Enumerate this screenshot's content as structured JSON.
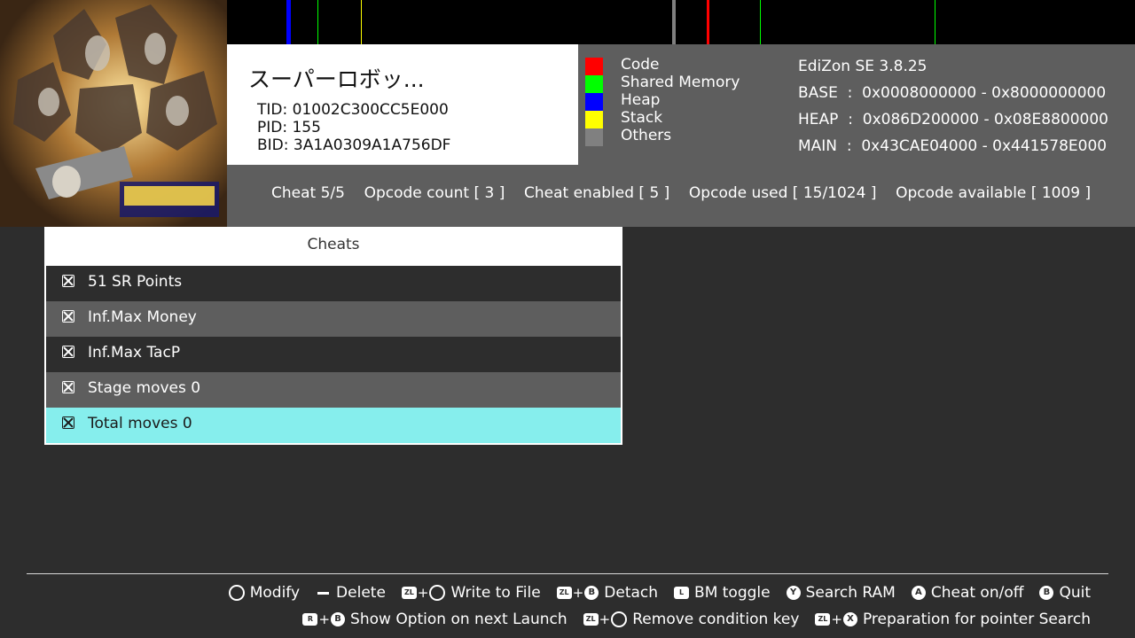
{
  "memory_legend": [
    {
      "label": "Code",
      "color": "#ff0000"
    },
    {
      "label": "Shared Memory",
      "color": "#00ff00"
    },
    {
      "label": "Heap",
      "color": "#0000ff"
    },
    {
      "label": "Stack",
      "color": "#ffff00"
    },
    {
      "label": "Others",
      "color": "#808080"
    }
  ],
  "game": {
    "title": "スーパーロボッ...",
    "tid": "TID: 01002C300CC5E000",
    "pid": "PID: 155",
    "bid": "BID: 3A1A0309A1A756DF",
    "cover_icon": "game-cover-art"
  },
  "mem_info": {
    "version": "EdiZon SE 3.8.25",
    "base": "BASE  :  0x0008000000 - 0x8000000000",
    "heap": "HEAP  :  0x086D200000 - 0x08E8800000",
    "main": "MAIN  :  0x43CAE04000 - 0x441578E000"
  },
  "stats": "Cheat 5/5    Opcode count [ 3 ]    Cheat enabled [ 5 ]    Opcode used [ 15/1024 ]    Opcode available [ 1009 ]",
  "cheats": {
    "header": "Cheats",
    "items": [
      {
        "label": "51 SR Points",
        "enabled": false,
        "selected": false
      },
      {
        "label": "Inf.Max Money",
        "enabled": false,
        "selected": false
      },
      {
        "label": "Inf.Max TacP",
        "enabled": false,
        "selected": false
      },
      {
        "label": "Stage moves 0",
        "enabled": false,
        "selected": false
      },
      {
        "label": "Total moves 0",
        "enabled": false,
        "selected": true
      }
    ]
  },
  "colors": {
    "background": "#2d2d2d",
    "row_dark": "#2d2d2d",
    "row_light": "#5e5e5e",
    "row_selected": "#86eeed",
    "panel": "#5e5e5e"
  },
  "footer": {
    "row1": [
      {
        "keys": "stick",
        "label": "Modify"
      },
      {
        "keys": "minus",
        "label": "Delete"
      },
      {
        "keys": "ZL + stick",
        "label": "Write to File"
      },
      {
        "keys": "ZL + B",
        "label": "Detach"
      },
      {
        "keys": "L",
        "label": "BM toggle"
      },
      {
        "keys": "Y",
        "label": "Search RAM"
      },
      {
        "keys": "A",
        "label": "Cheat on/off"
      },
      {
        "keys": "B",
        "label": "Quit"
      }
    ],
    "row2": [
      {
        "keys": "R + B",
        "label": "Show Option on next Launch"
      },
      {
        "keys": "ZL + stick",
        "label": "Remove condition key"
      },
      {
        "keys": "ZL + X",
        "label": "Preparation for pointer Search"
      }
    ]
  }
}
